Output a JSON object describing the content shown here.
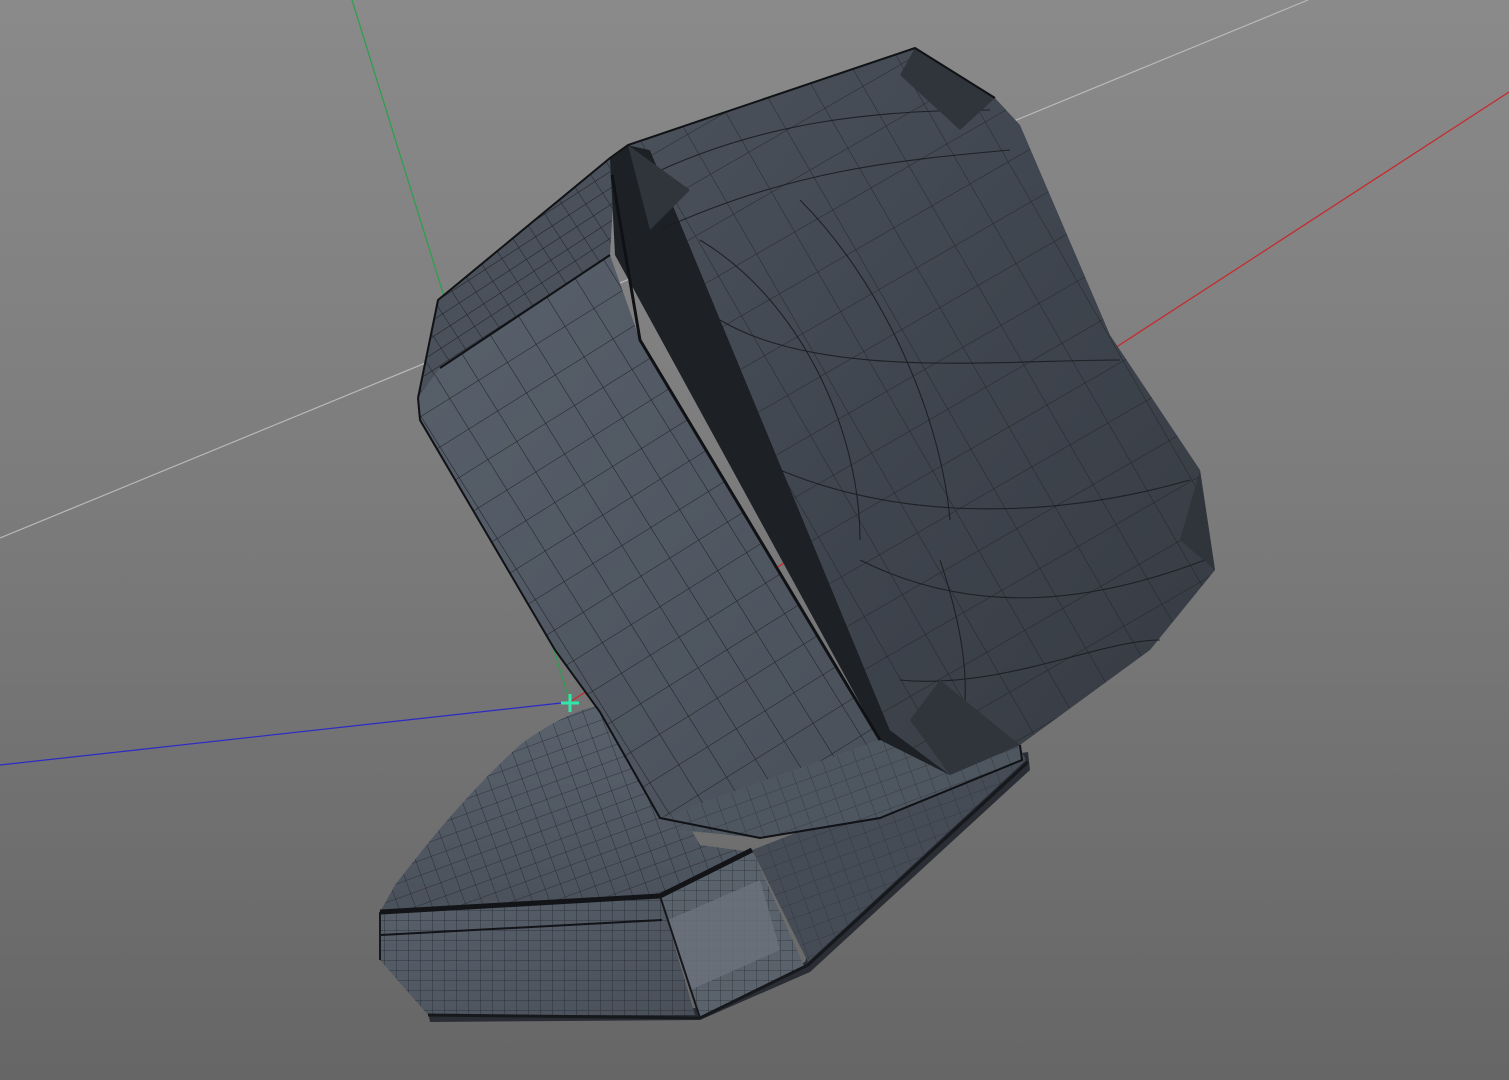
{
  "viewport": {
    "projection": "perspective",
    "background_top": "#8a8a8a",
    "background_bottom": "#666666"
  },
  "axes": {
    "x_color": "#c8282a",
    "y_color": "#2aa04a",
    "z_color": "#2a2ac8",
    "ground_line_color": "#b9b9b9"
  },
  "pivot": {
    "icon": "crosshair-plus-icon",
    "color": "#33e6a8"
  },
  "model": {
    "shading": "wireframe-on-shaded",
    "face_color": "#404650",
    "side_color": "#4a525d",
    "edge_color": "#14171b"
  }
}
